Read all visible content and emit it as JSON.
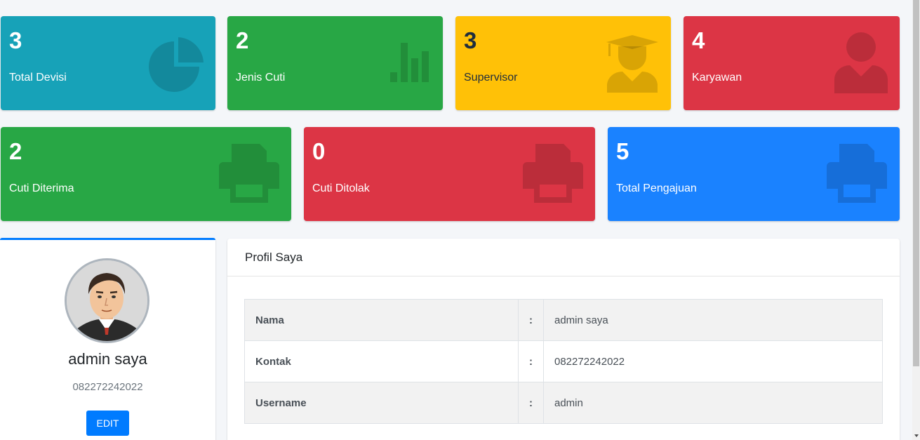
{
  "stats_row1": [
    {
      "value": "3",
      "label": "Total Devisi",
      "color": "#17a2b8",
      "icon": "pie-chart-icon"
    },
    {
      "value": "2",
      "label": "Jenis Cuti",
      "color": "#28a745",
      "icon": "bar-chart-icon"
    },
    {
      "value": "3",
      "label": "Supervisor",
      "color": "#ffc107",
      "icon": "graduate-icon"
    },
    {
      "value": "4",
      "label": "Karyawan",
      "color": "#dc3545",
      "icon": "user-tie-icon"
    }
  ],
  "stats_row2": [
    {
      "value": "2",
      "label": "Cuti Diterima",
      "color": "#28a745",
      "icon": "printer-icon"
    },
    {
      "value": "0",
      "label": "Cuti Ditolak",
      "color": "#dc3545",
      "icon": "printer-icon"
    },
    {
      "value": "5",
      "label": "Total Pengajuan",
      "color": "#007bff",
      "icon": "printer-icon"
    }
  ],
  "profile": {
    "name": "admin saya",
    "phone": "082272242022",
    "edit_label": "EDIT",
    "avatar_icon": "user-avatar-icon"
  },
  "detail": {
    "title": "Profil Saya",
    "rows": [
      {
        "key": "Nama",
        "sep": ":",
        "value": "admin saya"
      },
      {
        "key": "Kontak",
        "sep": ":",
        "value": "082272242022"
      },
      {
        "key": "Username",
        "sep": ":",
        "value": "admin"
      }
    ]
  }
}
